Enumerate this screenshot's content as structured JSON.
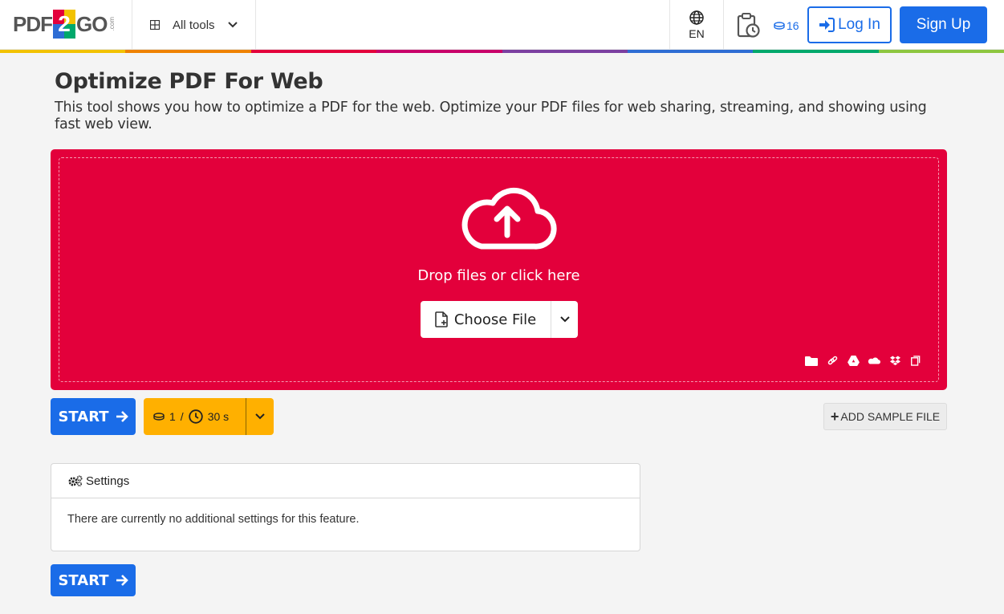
{
  "header": {
    "logo": {
      "left": "PDF",
      "mid": "2",
      "right": "GO",
      "suffix": ".com"
    },
    "all_tools_label": "All tools",
    "language": "EN",
    "credits": "16",
    "login_label": "Log In",
    "signup_label": "Sign Up"
  },
  "colors": {
    "accent_blue": "#1a6ce8",
    "dropzone_red": "#e3003b",
    "cost_yellow": "#ffb000",
    "rainbow": [
      "#f2c200",
      "#ef8200",
      "#e3003b",
      "#c8006a",
      "#7b3fa0",
      "#2e6dd4",
      "#00a86b",
      "#8dc63f"
    ]
  },
  "page": {
    "title": "Optimize PDF For Web",
    "description": "This tool shows you how to optimize a PDF for the web. Optimize your PDF files for web sharing, streaming, and showing using fast web view."
  },
  "upload": {
    "drop_text": "Drop files or click here",
    "choose_label": "Choose File",
    "sources": [
      "folder-icon",
      "link-icon",
      "google-drive-icon",
      "onedrive-icon",
      "dropbox-icon",
      "clipboard-icon"
    ]
  },
  "actions": {
    "start_label": "START",
    "cost_credits": "1",
    "cost_separator": "/",
    "cost_time": "30 s",
    "sample_label": "ADD SAMPLE FILE"
  },
  "settings": {
    "title": "Settings",
    "message": "There are currently no additional settings for this feature."
  }
}
